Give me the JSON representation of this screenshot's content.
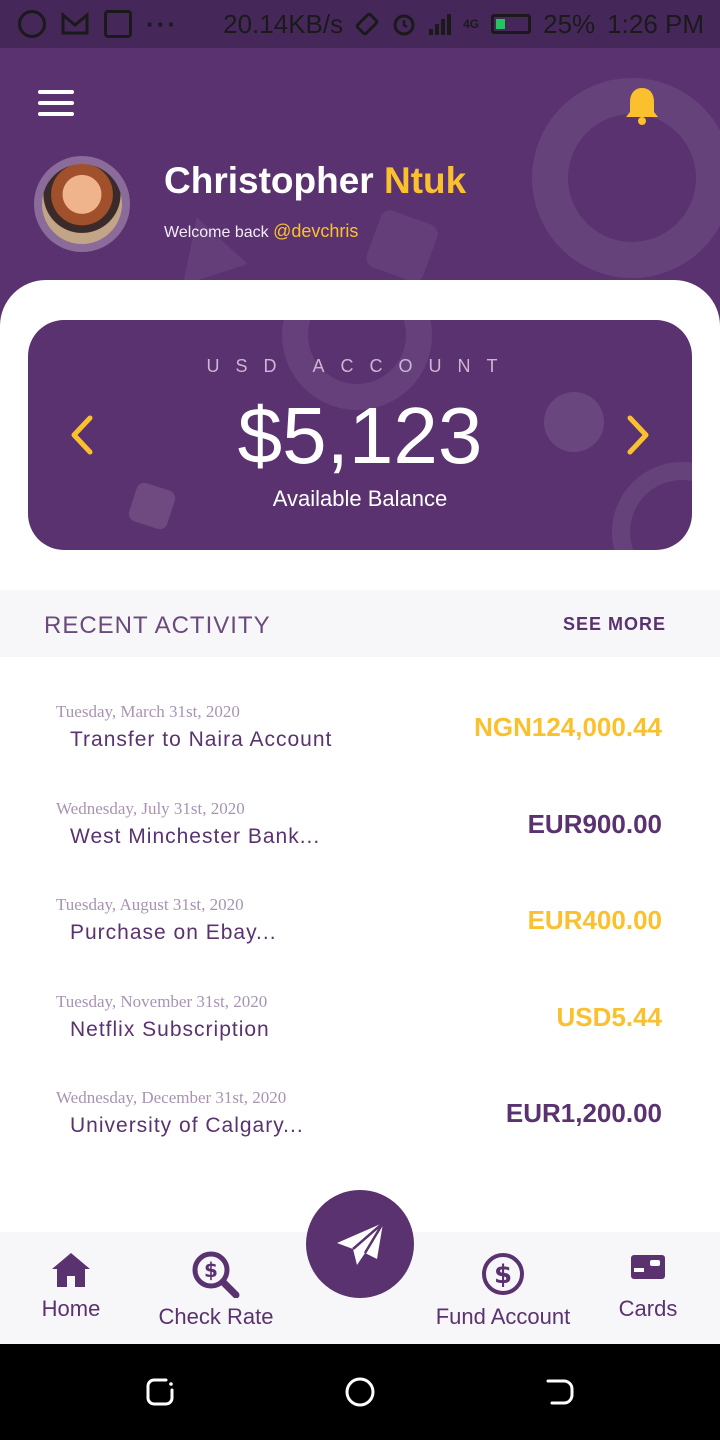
{
  "status_bar": {
    "speed": "20.14KB/s",
    "network": "4G",
    "battery": "25%",
    "time": "1:26 PM",
    "dots": "···"
  },
  "profile": {
    "first_name": "Christopher",
    "last_name": "Ntuk",
    "welcome_text": "Welcome back",
    "handle": "@devchris"
  },
  "balance": {
    "account_label": "USD ACCOUNT",
    "amount": "$5,123",
    "caption": "Available Balance"
  },
  "recent_activity": {
    "title": "RECENT ACTIVITY",
    "see_more": "SEE MORE",
    "items": [
      {
        "date": "Tuesday, March 31st, 2020",
        "description": "Transfer to Naira Account",
        "amount": "NGN124,000.44",
        "color": "#fbc02d"
      },
      {
        "date": "Wednesday, July 31st, 2020",
        "description": "West Minchester Bank...",
        "amount": "EUR900.00",
        "color": "#5a3270"
      },
      {
        "date": "Tuesday, August 31st, 2020",
        "description": "Purchase on Ebay...",
        "amount": "EUR400.00",
        "color": "#fbc02d"
      },
      {
        "date": "Tuesday, November 31st, 2020",
        "description": "Netflix Subscription",
        "amount": "USD5.44",
        "color": "#fbc02d"
      },
      {
        "date": "Wednesday, December 31st, 2020",
        "description": "University of Calgary...",
        "amount": "EUR1,200.00",
        "color": "#5a3270"
      }
    ]
  },
  "bottom_nav": {
    "home": "Home",
    "check_rate": "Check Rate",
    "fund_account": "Fund Account",
    "cards": "Cards"
  },
  "colors": {
    "primary": "#5a3270",
    "accent": "#fbc02d",
    "surface": "#ffffff"
  },
  "icons": [
    "whatsapp-icon",
    "gmail-icon",
    "cast-icon",
    "rotate-icon",
    "alarm-icon",
    "signal-icon",
    "battery-icon",
    "menu-icon",
    "bell-icon",
    "chevron-left-icon",
    "chevron-right-icon",
    "home-icon",
    "search-dollar-icon",
    "send-icon",
    "dollar-circle-icon",
    "card-icon",
    "recents-icon",
    "home-circle-icon",
    "back-icon"
  ]
}
